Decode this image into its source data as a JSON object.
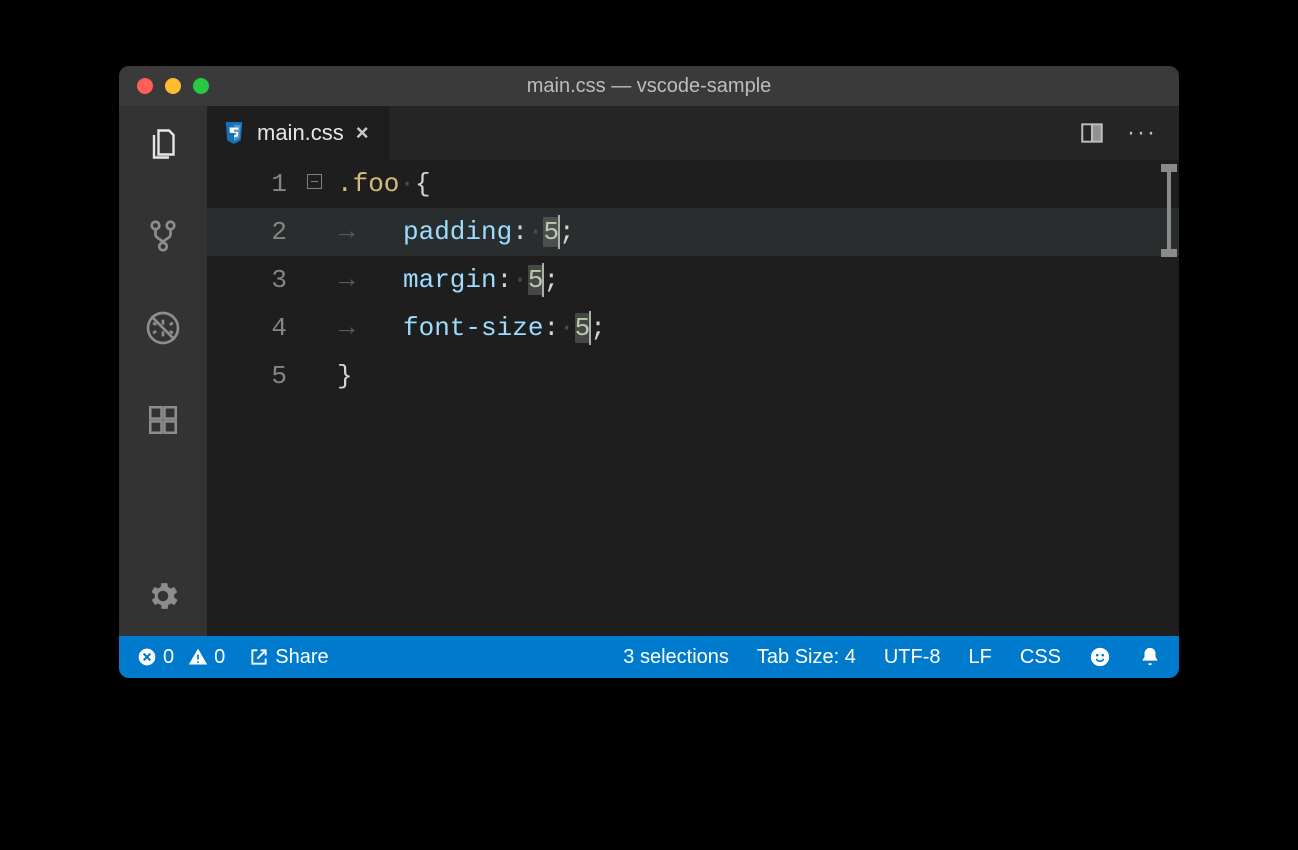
{
  "window": {
    "title": "main.css — vscode-sample"
  },
  "tab": {
    "filename": "main.css"
  },
  "code": {
    "lines": [
      "1",
      "2",
      "3",
      "4",
      "5"
    ],
    "selector": ".foo",
    "open_brace": "{",
    "close_brace": "}",
    "prop1": "padding",
    "prop2": "margin",
    "prop3": "font-size",
    "val": "5",
    "colon": ":",
    "semicolon": ";"
  },
  "status": {
    "errors": "0",
    "warnings": "0",
    "share": "Share",
    "selections": "3 selections",
    "tabsize": "Tab Size: 4",
    "encoding": "UTF-8",
    "eol": "LF",
    "language": "CSS"
  }
}
